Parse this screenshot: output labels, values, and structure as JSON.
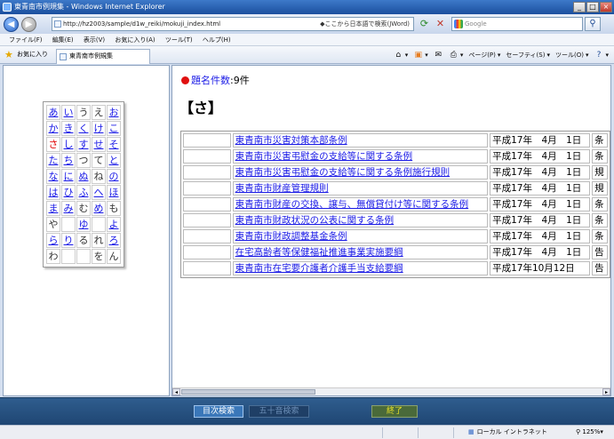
{
  "window": {
    "title": "東青南市例規集 - Windows Internet Explorer",
    "controls": [
      "_",
      "□",
      "×"
    ]
  },
  "address": {
    "url": "http://hz2003/sample/d1w_reiki/mokuji_index.html",
    "search_hint": "◆ここから日本語で検索(JWord)"
  },
  "search": {
    "placeholder": "Google"
  },
  "menu": [
    "ファイル(F)",
    "編集(E)",
    "表示(V)",
    "お気に入り(A)",
    "ツール(T)",
    "ヘルプ(H)"
  ],
  "favorites": {
    "label": "お気に入り",
    "tab_title": "東青南市例規集"
  },
  "commandbar": {
    "page": "ページ(P)",
    "safety": "セーフティ(S)",
    "tools": "ツール(O)"
  },
  "kana_grid": [
    [
      "あ",
      "い",
      "う",
      "え",
      "お"
    ],
    [
      "か",
      "き",
      "く",
      "け",
      "こ"
    ],
    [
      "さ",
      "し",
      "す",
      "せ",
      "そ"
    ],
    [
      "た",
      "ち",
      "つ",
      "て",
      "と"
    ],
    [
      "な",
      "に",
      "ぬ",
      "ね",
      "の"
    ],
    [
      "は",
      "ひ",
      "ふ",
      "へ",
      "ほ"
    ],
    [
      "ま",
      "み",
      "む",
      "め",
      "も"
    ],
    [
      "や",
      "",
      "ゆ",
      "",
      "よ"
    ],
    [
      "ら",
      "り",
      "る",
      "れ",
      "ろ"
    ],
    [
      "わ",
      "",
      "",
      "を",
      "ん"
    ]
  ],
  "main": {
    "count_label": "題名件数",
    "count_value": ":9件",
    "heading": "【さ】",
    "rows": [
      {
        "title": "東青南市災害対策本部条例",
        "date": "平成17年　4月　1日",
        "kind": "条"
      },
      {
        "title": "東青南市災害弔慰金の支給等に関する条例",
        "date": "平成17年　4月　1日",
        "kind": "条"
      },
      {
        "title": "東青南市災害弔慰金の支給等に関する条例施行規則",
        "date": "平成17年　4月　1日",
        "kind": "規"
      },
      {
        "title": "東青南市財産管理規則",
        "date": "平成17年　4月　1日",
        "kind": "規"
      },
      {
        "title": "東青南市財産の交換、譲与、無償貸付け等に関する条例",
        "date": "平成17年　4月　1日",
        "kind": "条"
      },
      {
        "title": "東青南市財政状況の公表に関する条例",
        "date": "平成17年　4月　1日",
        "kind": "条"
      },
      {
        "title": "東青南市財政調整基金条例",
        "date": "平成17年　4月　1日",
        "kind": "条"
      },
      {
        "title": "在宅高齢者等保健福祉推進事業実施要綱",
        "date": "平成17年　4月　1日",
        "kind": "告"
      },
      {
        "title": "東青南市在宅要介護者介護手当支給要綱",
        "date": "平成17年10月12日",
        "kind": "告"
      }
    ]
  },
  "buttons": {
    "toc": "目次検索",
    "gojuon": "五十音検索",
    "exit": "終了"
  },
  "status": {
    "zone": "ローカル イントラネット",
    "zoom": "125%"
  },
  "colors": {
    "bottom_bar": "#2f5d8e",
    "link": "#1a1ae6",
    "marker": "#e01010"
  }
}
